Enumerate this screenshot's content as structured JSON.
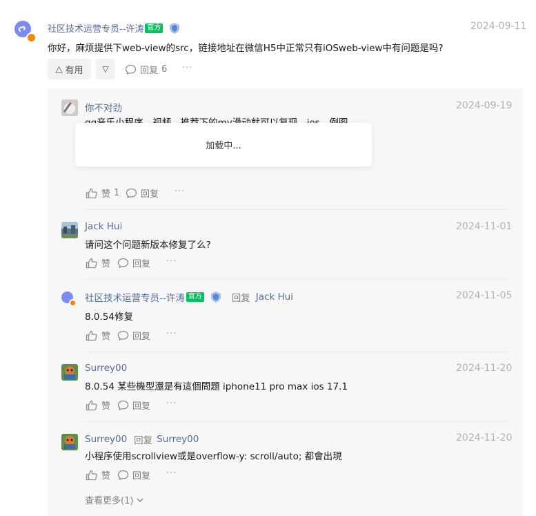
{
  "main": {
    "author": "社区技术运营专员--许涛",
    "badge": "官方",
    "date": "2024-09-11",
    "content": "你好，麻烦提供下web-view的src，链接地址在微信H5中正常只有iOSweb-view中有问题是吗?",
    "useful_label": "有用",
    "reply_label": "回复",
    "reply_count": "6",
    "more": "···"
  },
  "replies": [
    {
      "author": "你不对劲",
      "date": "2024-09-19",
      "content": "qq音乐小程序，视频，推荐下的my滑动就可以复现，ios，例图",
      "like_label": "赞",
      "like_count": "1",
      "reply_label": "回复",
      "more": "···",
      "loading": "加载中..."
    },
    {
      "author": "Jack Hui",
      "date": "2024-11-01",
      "content": "请问这个问题新版本修复了么?",
      "like_label": "赞",
      "reply_label": "回复",
      "more": "···"
    },
    {
      "author": "社区技术运营专员--许涛",
      "badge": "官方",
      "reply_word": "回复",
      "reply_to": "Jack Hui",
      "date": "2024-11-05",
      "content": "8.0.54修复",
      "like_label": "赞",
      "reply_label": "回复",
      "more": "···"
    },
    {
      "author": "Surrey00",
      "date": "2024-11-20",
      "content": "8.0.54 某些機型還是有這個問題 iphone11 pro max ios 17.1",
      "like_label": "赞",
      "reply_label": "回复",
      "more": "···"
    },
    {
      "author": "Surrey00",
      "reply_word": "回复",
      "reply_to": "Surrey00",
      "date": "2024-11-20",
      "content": "小程序使用scrollview或是overflow-y: scroll/auto; 都會出現",
      "like_label": "赞",
      "reply_label": "回复",
      "more": "···"
    }
  ],
  "see_more": "查看更多(1)",
  "colors": {
    "accent": "#576b95",
    "official": "#07c160",
    "panel": "#f7f7f7"
  }
}
